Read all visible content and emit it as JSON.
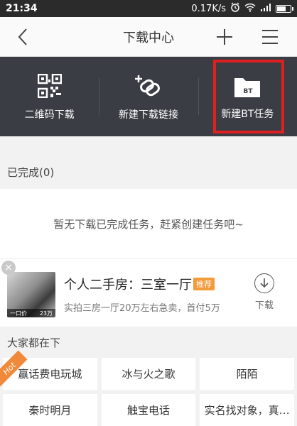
{
  "status_bar": {
    "time": "21:34",
    "speed": "0.17K/s",
    "icons": [
      "alarm-icon",
      "wifi-icon",
      "signal-icon",
      "battery-icon"
    ]
  },
  "header": {
    "title": "下载中心",
    "back_icon": "chevron-left-icon",
    "add_icon": "plus-icon",
    "menu_icon": "hamburger-icon"
  },
  "actions": [
    {
      "label": "二维码下载",
      "icon": "qrcode-icon"
    },
    {
      "label": "新建下载链接",
      "icon": "link-add-icon"
    },
    {
      "label": "新建BT任务",
      "icon": "bt-folder-icon",
      "icon_text": "BT"
    }
  ],
  "completed": {
    "label": "已完成(0)",
    "empty_message": "暂无下载已完成任务，赶紧创建任务吧~"
  },
  "ad": {
    "title": "个人二手房：三室一厅",
    "tag": "推荐",
    "description": "实拍三房一厅20万左右急卖，首付5万",
    "download_label": "下载",
    "thumb_caption_left": "一口价",
    "thumb_caption_right": "23万"
  },
  "popular": {
    "label": "大家都在下",
    "hot_badge": "Hot",
    "items": [
      "赢话费电玩城",
      "冰与火之歌",
      "陌陌",
      "秦时明月",
      "触宝电话",
      "实名找对象，真…"
    ]
  },
  "colors": {
    "action_bg": "#3a3d44",
    "highlight_border": "#e02020",
    "tag_bg": "#f39a3b"
  }
}
